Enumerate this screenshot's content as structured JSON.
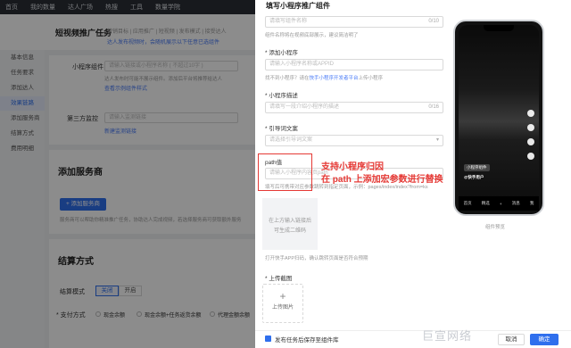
{
  "topnav": [
    "首页",
    "我的数量",
    "达人广场",
    "热搜",
    "工具",
    "数量学院"
  ],
  "subhead": {
    "title": "短视频推广任务",
    "line1": "营销目标 | 应用推广 | 短视频 | 发布模式 | 接受达人",
    "line2": "达人发布视频时，会随机展示以下任意已选组件"
  },
  "sidenav": {
    "items": [
      "基本信息",
      "任务要求",
      "添加达人",
      "效果链路",
      "添加服务商",
      "结算方式",
      "费用明细"
    ],
    "active_index": 3
  },
  "main": {
    "widget_label": "小程序组件",
    "widget_placeholder": "请输入链接或小程序名称 ( 不超过10字 )",
    "widget_hint": "达人发布时可能不展示组件。添加后平台将推荐给达人",
    "widget_link": "查看示例组件样式",
    "monitor_label": "第三方监控",
    "monitor_placeholder": "请输入监测链接",
    "monitor_link": "新建监测链接",
    "service_title": "添加服务商",
    "add_service_button": "+ 添加服务商",
    "service_hint": "服务商可以帮助你精准推广任务，协助达人完成视频，若选择服务商可获取额外服务",
    "settle_title": "结算方式",
    "settle_mode_label": "结算模式",
    "settle_on": "关闭",
    "settle_off": "开启",
    "pay_label": "* 支付方式",
    "pay_opt1": "现金余额",
    "pay_opt2": "现金余额+任务返货余额",
    "pay_opt3": "代理金额余额"
  },
  "drawer": {
    "title": "填写小程序推广组件",
    "name_placeholder": "请填写组件名称",
    "name_count": "0/10",
    "name_hint": "组件名称将在视频底部展示，建议简洁明了",
    "add_mp_label": "* 添加小程序",
    "add_mp_placeholder": "请输入小程序名称或APPID",
    "add_mp_hint_prefix": "找不到小程序？请在",
    "add_mp_hint_link": "快手小程序开发者平台",
    "add_mp_hint_suffix": "上传小程序",
    "desc_label": "* 小程序描述",
    "desc_placeholder": "请填写一段介绍小程序的描述",
    "desc_count": "0/16",
    "guide_label": "* 引导词文案",
    "guide_placeholder": "请选择引导词文案",
    "path_label": "path值",
    "path_placeholder": "请输入小程序内容页path",
    "path_hint": "填写后可携带对应参数跳转到指定页面，示例：pages/index/index?from=ks",
    "qr_line1": "在上方输入链接后",
    "qr_line2": "可生成二维码",
    "qr_hint": "打开快手APP扫码，确认跳转页面是否符合预期",
    "cover_label": "* 上传截图",
    "upload_label": "上传图片",
    "footer_checkbox": "发布任务后保存至组件库",
    "cancel_button": "取消",
    "confirm_button": "确定"
  },
  "annotation": {
    "line1": "支持小程序归因",
    "line2": "在 path 上添加宏参数进行替换"
  },
  "phone": {
    "caption": "组件预览",
    "username": "@快手用户",
    "desc": "小程序组件",
    "tabs": [
      "首页",
      "精选",
      "+",
      "消息",
      "我"
    ]
  },
  "watermark": "巨宣网络"
}
